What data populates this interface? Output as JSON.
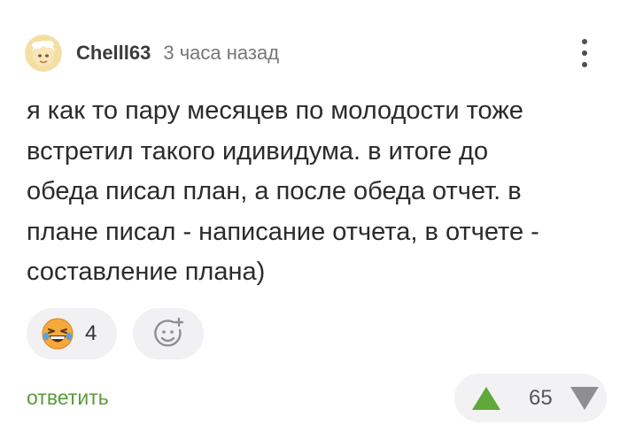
{
  "comment": {
    "author": "Chelll63",
    "time": "3 часа назад",
    "text": "я как то пару месяцев по молодости тоже\nвстретил такого идивидума. в итоге до\nобеда писал план, а после обеда отчет. в\nплане писал - написание отчета, в отчете -\nсоставление плана)"
  },
  "reactions": [
    {
      "icon": "laughing-emoji-icon",
      "count": "4"
    },
    {
      "icon": "add-reaction-icon"
    }
  ],
  "actions": {
    "reply_label": "ответить",
    "score": "65"
  },
  "colors": {
    "reply_green": "#5a9b3c",
    "upvote_green": "#5fa83a",
    "downvote_gray": "#8e8e93",
    "pill_background": "#f1f1f3"
  }
}
